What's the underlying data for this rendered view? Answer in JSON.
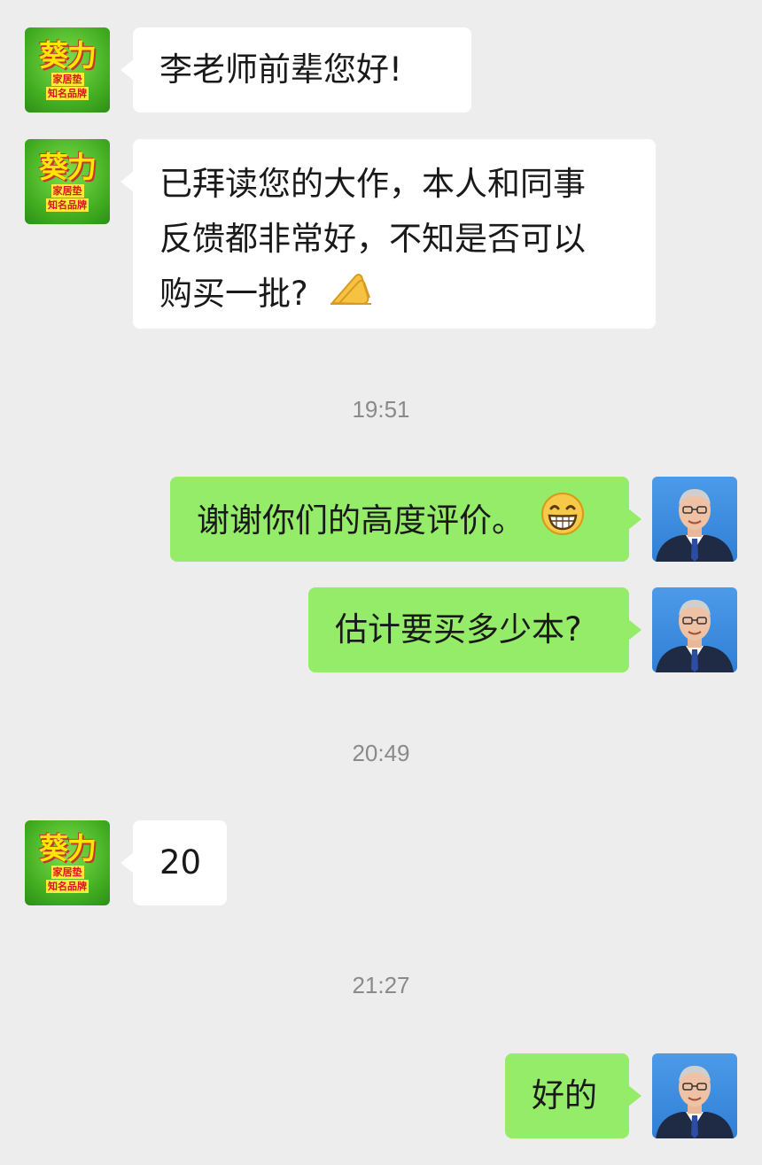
{
  "contacts": {
    "brand_avatar": {
      "title": "葵力",
      "subtitle_line1": "家居垫",
      "subtitle_line2": "知名品牌"
    }
  },
  "messages": [
    {
      "side": "left",
      "text": "李老师前辈您好!"
    },
    {
      "side": "left",
      "line1": "已拜读您的大作，本人和同事",
      "line2": "反馈都非常好，不知是否可以",
      "line3": "购买一批?",
      "emoji": "palms-together-emoji"
    },
    {
      "side": "time",
      "text": "19:51"
    },
    {
      "side": "right",
      "text": "谢谢你们的高度评价。",
      "emoji": "grinning-face-emoji"
    },
    {
      "side": "right",
      "text": "估计要买多少本?"
    },
    {
      "side": "time",
      "text": "20:49"
    },
    {
      "side": "left",
      "text": "20"
    },
    {
      "side": "time",
      "text": "21:27"
    },
    {
      "side": "right",
      "text": "好的"
    }
  ],
  "colors": {
    "background": "#ededed",
    "left_bubble": "#ffffff",
    "right_bubble": "#95ec69",
    "timestamp": "#8a8a8a"
  }
}
